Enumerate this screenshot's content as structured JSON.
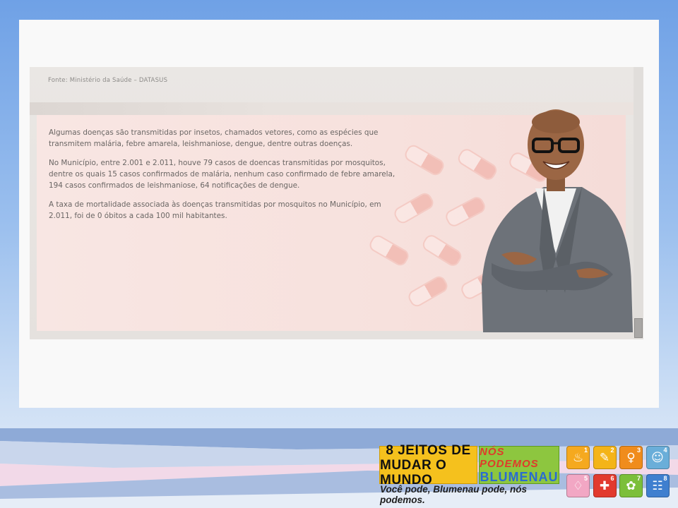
{
  "source_note": "Fonte: Ministério da Saúde – DATASUS",
  "paragraphs": [
    "Algumas doenças são transmitidas por insetos, chamados vetores, como as espécies que transmitem malária, febre amarela, leishmaniose, dengue, dentre outras doenças.",
    "No Município, entre 2.001 e 2.011, houve 79 casos de doencas transmitidas por mosquitos, dentre os quais 15 casos confirmados de malária, nenhum caso confirmado de febre amarela, 194 casos confirmados de leishmaniose, 64 notificações de dengue.",
    "A taxa de mortalidade associada às doenças transmitidas por mosquitos no Município, em 2.011, foi de 0 óbitos a cada 100 mil habitantes."
  ],
  "footer": {
    "logo_line1": "8 JEITOS DE",
    "logo_line2": "MUDAR O MUNDO",
    "campaign_line1": "NÓS PODEMOS",
    "campaign_line2": "BLUMENAU",
    "tagline": "Você pode, Blumenau pode, nós podemos.",
    "goals": [
      {
        "num": "1",
        "icon": "bowl-icon",
        "glyph": "♨",
        "color": "#f5a91f"
      },
      {
        "num": "2",
        "icon": "pencil-icon",
        "glyph": "✎",
        "color": "#f4b418"
      },
      {
        "num": "3",
        "icon": "female-symbol-icon",
        "glyph": "♀",
        "color": "#f08c1c"
      },
      {
        "num": "4",
        "icon": "child-icon",
        "glyph": "☺",
        "color": "#6aaed9"
      },
      {
        "num": "5",
        "icon": "pregnant-woman-icon",
        "glyph": "♢",
        "color": "#f2a7c4"
      },
      {
        "num": "6",
        "icon": "medicine-icon",
        "glyph": "✚",
        "color": "#e23a2e"
      },
      {
        "num": "7",
        "icon": "plant-icon",
        "glyph": "✿",
        "color": "#7cbf3a"
      },
      {
        "num": "8",
        "icon": "people-icon",
        "glyph": "☷",
        "color": "#3f7fcf"
      }
    ]
  }
}
